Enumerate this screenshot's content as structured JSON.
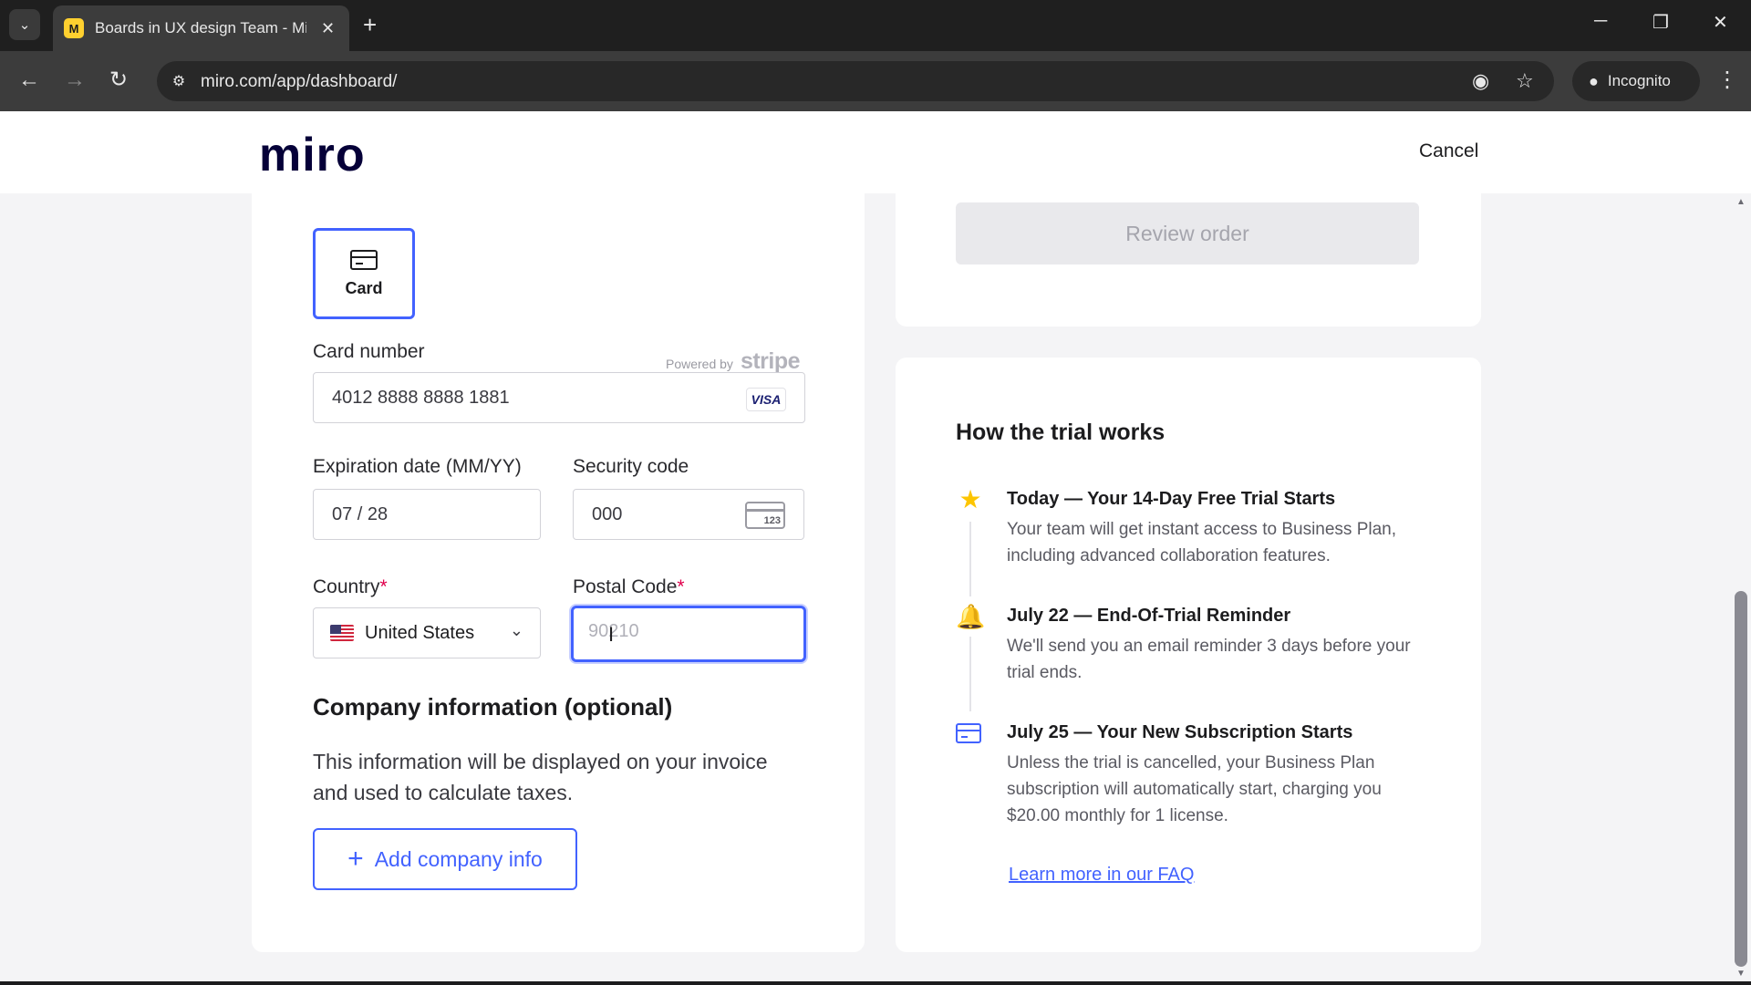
{
  "browser": {
    "tab_title": "Boards in UX design Team - Miro",
    "tab_favicon": "M",
    "url": "miro.com/app/dashboard/",
    "incognito_label": "Incognito"
  },
  "header": {
    "logo": "miro",
    "cancel_label": "Cancel"
  },
  "payment": {
    "method_label": "Card",
    "card_number_label": "Card number",
    "powered_by": "Powered by",
    "powered_brand": "stripe",
    "card_number_value": "4012 8888 8888 1881",
    "card_brand": "VISA",
    "expiration_label": "Expiration date (MM/YY)",
    "expiration_value": "07 / 28",
    "security_label": "Security code",
    "security_value": "000",
    "cvc_icon_text": "123",
    "country_label": "Country",
    "country_value": "United States",
    "postal_label": "Postal Code",
    "postal_placeholder": "90210",
    "required_mark": "*"
  },
  "company": {
    "title": "Company information (optional)",
    "description": "This information will be displayed on your invoice and used to calculate taxes.",
    "add_button_label": "Add company info"
  },
  "order": {
    "review_button_label": "Review order"
  },
  "trial": {
    "title": "How the trial works",
    "steps": [
      {
        "title": "Today — Your 14-Day Free Trial Starts",
        "description": "Your team will get instant access to Business Plan, including advanced collaboration features."
      },
      {
        "title": "July 22 — End-Of-Trial Reminder",
        "description": "We'll send you an email reminder 3 days before your trial ends."
      },
      {
        "title": "July 25 — Your New Subscription Starts",
        "description": "Unless the trial is cancelled, your Business Plan subscription will automatically start, charging you $20.00 monthly for 1 license."
      }
    ],
    "faq_link": "Learn more in our FAQ"
  },
  "colors": {
    "accent": "#4262ff",
    "star": "#fdc500",
    "required": "#e0004c"
  }
}
